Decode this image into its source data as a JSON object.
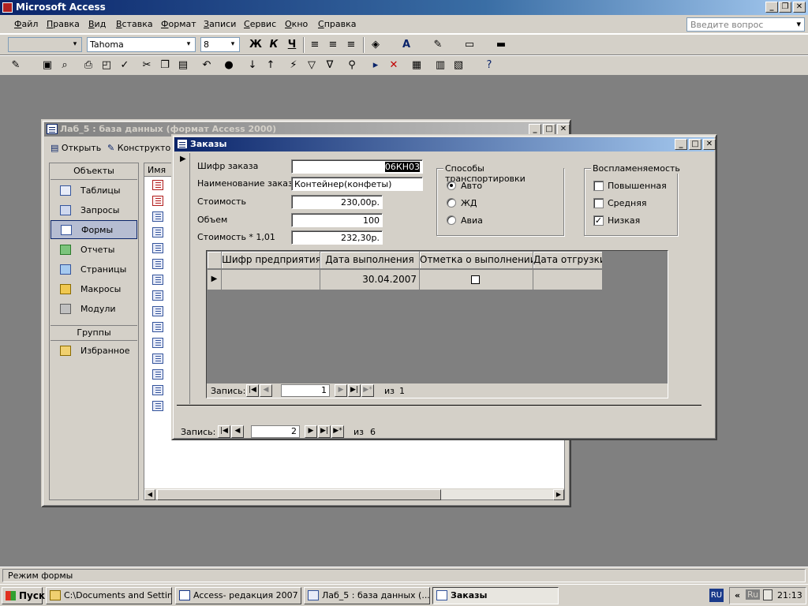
{
  "app": {
    "title": "Microsoft Access"
  },
  "menu": [
    "Файл",
    "Правка",
    "Вид",
    "Вставка",
    "Формат",
    "Записи",
    "Сервис",
    "Окно",
    "Справка"
  ],
  "question_placeholder": "Введите вопрос",
  "format_toolbar": {
    "font": "Tahoma",
    "size": "8",
    "bold": "Ж",
    "italic": "К",
    "underline": "Ч"
  },
  "db_window": {
    "title": "Лаб_5 : база данных (формат Access 2000)",
    "open_label": "Открыть",
    "design_label": "Конструктор",
    "objects_header": "Объекты",
    "objects": [
      "Таблицы",
      "Запросы",
      "Формы",
      "Отчеты",
      "Страницы",
      "Макросы",
      "Модули"
    ],
    "groups_header": "Группы",
    "groups": [
      "Избранное"
    ],
    "list_header": "Имя"
  },
  "form": {
    "title": "Заказы",
    "fields": {
      "order_code_label": "Шифр заказа",
      "order_code": "06КН03",
      "order_name_label": "Наименование заказа",
      "order_name": "Контейнер(конфеты)",
      "cost_label": "Стоимость",
      "cost": "230,00р.",
      "volume_label": "Объем",
      "volume": "100",
      "cost2_label": "Стоимость * 1,01",
      "cost2": "232,30р."
    },
    "transport": {
      "title": "Способы транспортировки",
      "options": [
        "Авто",
        "ЖД",
        "Авиа"
      ],
      "selected": "Авто"
    },
    "flammability": {
      "title": "Воспламеняемость",
      "options": [
        "Повышенная",
        "Средняя",
        "Низкая"
      ],
      "checked": "Низкая"
    },
    "subform": {
      "columns": [
        "Шифр предприятия",
        "Дата выполнения",
        "Отметка о выполнении",
        "Дата отгрузки"
      ],
      "rows": [
        {
          "enterprise": "",
          "date_done": "30.04.2007",
          "done_mark": false,
          "ship_date": ""
        }
      ],
      "nav": {
        "label": "Запись:",
        "current": "1",
        "of_label": "из",
        "total": "1"
      }
    },
    "nav": {
      "label": "Запись:",
      "current": "2",
      "of_label": "из",
      "total": "6"
    }
  },
  "status": "Режим формы",
  "taskbar": {
    "start": "Пуск",
    "tasks": [
      "C:\\Documents and Settin...",
      "Access- редакция 2007 ...",
      "Лаб_5 : база данных (...",
      "Заказы"
    ],
    "lang": "RU",
    "tray_lang": "Ru",
    "time": "21:13"
  }
}
